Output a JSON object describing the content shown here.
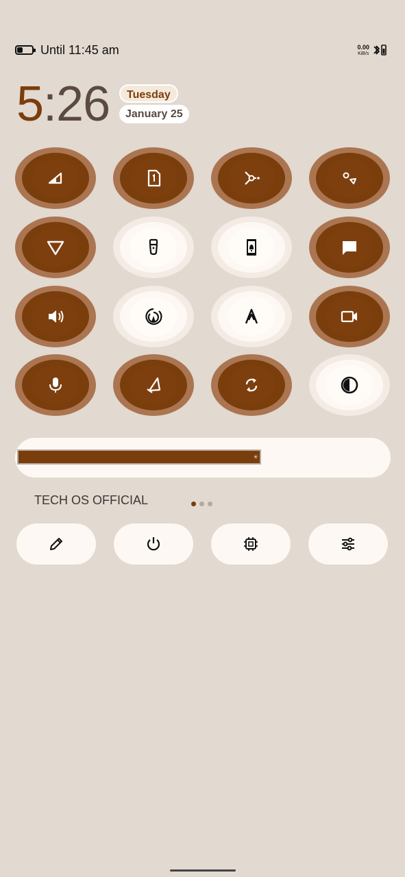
{
  "status_bar": {
    "until_text": "Until 11:45 am",
    "net_speed": "0.00",
    "net_unit": "KiB/s",
    "battery_percent": 35
  },
  "clock": {
    "hour": "5",
    "rest": ":26"
  },
  "date": {
    "day": "Tuesday",
    "date": "January 25"
  },
  "tiles": [
    {
      "name": "mobile-data-tile",
      "icon": "signal-icon",
      "state": "on"
    },
    {
      "name": "sim-tile",
      "icon": "sim-card-icon",
      "state": "on"
    },
    {
      "name": "nfc-tile",
      "icon": "share-icon",
      "state": "on"
    },
    {
      "name": "ambient-tile",
      "icon": "shapes-icon",
      "state": "on"
    },
    {
      "name": "vpn-tile",
      "icon": "triangle-icon",
      "state": "on"
    },
    {
      "name": "flashlight-tile",
      "icon": "flashlight-icon",
      "state": "off"
    },
    {
      "name": "notification-tile",
      "icon": "phone-bell-icon",
      "state": "off"
    },
    {
      "name": "message-tile",
      "icon": "message-icon",
      "state": "on"
    },
    {
      "name": "sound-tile",
      "icon": "volume-icon",
      "state": "on"
    },
    {
      "name": "hotspot-tile",
      "icon": "hotspot-icon",
      "state": "off"
    },
    {
      "name": "adaptive-tile",
      "icon": "caret-icon",
      "state": "off"
    },
    {
      "name": "screen-record-tile",
      "icon": "video-icon",
      "state": "on"
    },
    {
      "name": "mic-tile",
      "icon": "microphone-icon",
      "state": "on"
    },
    {
      "name": "bell-tile",
      "icon": "bell-icon",
      "state": "on"
    },
    {
      "name": "rotate-tile",
      "icon": "sync-icon",
      "state": "on"
    },
    {
      "name": "contrast-tile",
      "icon": "contrast-icon",
      "state": "off"
    }
  ],
  "brightness": {
    "level": 0.65
  },
  "brand": "TECH OS OFFICIAL",
  "pager": {
    "pages": 3,
    "active": 0
  },
  "footer_buttons": [
    "edit-icon",
    "power-icon",
    "chip-icon",
    "sliders-icon"
  ]
}
